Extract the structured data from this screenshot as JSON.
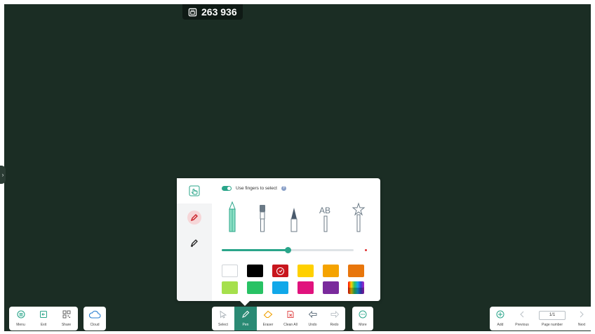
{
  "board": {
    "code": "263 936",
    "background": "#1b2d24",
    "edge_handle": "›"
  },
  "pen_panel": {
    "finger_toggle_label": "Use fingers to select",
    "finger_toggle_on": true,
    "help_label": "?",
    "modes": [
      "hand-touch-icon",
      "pen-red-icon",
      "highlighter-icon"
    ],
    "pens": [
      "pencil-pen-icon",
      "brush-pen-icon",
      "fountain-pen-icon",
      "text-recognition-pen-icon",
      "magic-pen-icon"
    ],
    "pen_text_label": "AB",
    "size_level_fraction": 0.5,
    "colors": [
      {
        "name": "white",
        "hex": "#ffffff"
      },
      {
        "name": "black",
        "hex": "#000000"
      },
      {
        "name": "red",
        "hex": "#c8161d",
        "selected": true
      },
      {
        "name": "yellow",
        "hex": "#ffd000"
      },
      {
        "name": "orange",
        "hex": "#f5a300"
      },
      {
        "name": "dark-orange",
        "hex": "#e8760c"
      },
      {
        "name": "light-green",
        "hex": "#a6e04c"
      },
      {
        "name": "green",
        "hex": "#28c264"
      },
      {
        "name": "cyan",
        "hex": "#11a8e9"
      },
      {
        "name": "magenta",
        "hex": "#e0127d"
      },
      {
        "name": "purple",
        "hex": "#7a2a9c"
      },
      {
        "name": "rainbow",
        "hex": "multicolor"
      }
    ]
  },
  "left_bar": {
    "menu": "Menu",
    "exit": "Exit",
    "share": "Share",
    "cloud": "Cloud"
  },
  "center_bar": {
    "select": "Select",
    "pen": "Pen",
    "eraser": "Eraser",
    "clean_all": "Clean All",
    "undo": "Undo",
    "redo": "Redo",
    "more": "More"
  },
  "right_bar": {
    "add": "Add",
    "previous": "Previous",
    "page_value": "1/1",
    "page_number": "Page number",
    "next": "Next"
  },
  "colors": {
    "accent": "#2aa58a",
    "accent_dark": "#2a8a74"
  }
}
